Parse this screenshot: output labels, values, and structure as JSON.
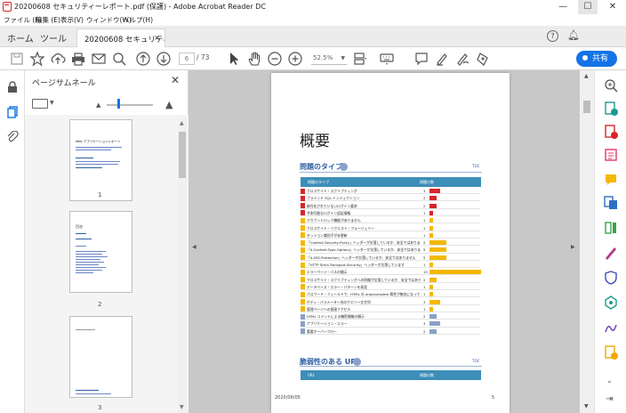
{
  "window": {
    "title": "20200608 セキュリティーレポート.pdf (保護) - Adobe Acrobat Reader DC",
    "controls": {
      "minimize": "—",
      "maximize": "☐",
      "close": "✕"
    }
  },
  "menu": [
    "ファイル (F)",
    "編集 (E)",
    "表示(V)",
    "ウィンドウ(W)",
    "ヘルプ(H)"
  ],
  "tabs": {
    "home": "ホーム",
    "tools": "ツール",
    "document": "20200608 セキュリティ...",
    "close": "×"
  },
  "toolbar": {
    "page_current": "6",
    "page_total": "/ 73",
    "zoom": "52.5%",
    "share_label": "共有"
  },
  "thumbnails": {
    "title": "ページサムネール",
    "close": "✕",
    "items": [
      {
        "label": "1",
        "heading": "Web アプリケーションレポート"
      },
      {
        "label": "2",
        "heading": "目次"
      },
      {
        "label": "3",
        "heading": ""
      }
    ]
  },
  "page": {
    "title": "概要",
    "section1": {
      "heading": "問題のタイプ",
      "top_link": "TOC",
      "col_type": "問題のタイプ",
      "col_count": "問題の数"
    },
    "section2": {
      "heading": "脆弱性のある URL",
      "top_link": "TOC",
      "col_url": "URL",
      "col_count": "問題の数"
    },
    "footer_date": "2020/06/05",
    "footer_page": "5"
  },
  "colors": {
    "high": "#d6262b",
    "medium": "#f5b800",
    "low": "#8aa0c8",
    "info": "#8aa0c8",
    "accent": "#1473e6",
    "table_header": "#3d8eb9"
  },
  "chart_data": {
    "type": "bar",
    "title": "問題のタイプ",
    "categories": [
      "クロスサイト・スクリプティング",
      "ブラインド SQL インジェクション",
      "暗号化されていないログイン要求",
      "予測可能なログイン認証情報",
      "アカウントロック機能がありません",
      "クロスサイト・リクエスト・フォージェリー",
      "セッション識別子が未更新",
      "「Content-Security-Policy」ヘッダーが欠落しているか、安全ではありません",
      "「X-Content-Type-Options」ヘッダーが欠落しているか、安全ではありません",
      "「X-XSS-Protection」ヘッダーが欠落しているか、安全ではありません",
      "「HTTP Strict-Transport-Security」ヘッダーが欠落しています",
      "エラーページ・パスの開示",
      "クロスサイト・スクリプティングへの防御が欠落しているか、安全ではありません",
      "データベース・エラー・パターンを発見",
      "パスワード・フィールドで、HTML の autocomplete 属性が無効になっていません",
      "ボディ・パラメーター内のクエリー文字列",
      "管理ページへの直接アクセス",
      "HTML コメントによる機密情報の開示",
      "アプリケーション・エラー",
      "重要オーバーフロー"
    ],
    "values": [
      3,
      2,
      2,
      1,
      1,
      1,
      1,
      5,
      5,
      5,
      1,
      15,
      2,
      1,
      1,
      3,
      1,
      2,
      3,
      2
    ],
    "severity": [
      "high",
      "high",
      "high",
      "high",
      "medium",
      "medium",
      "medium",
      "medium",
      "medium",
      "medium",
      "medium",
      "medium",
      "medium",
      "medium",
      "medium",
      "medium",
      "medium",
      "low",
      "low",
      "info"
    ],
    "xlabel": "",
    "ylabel": ""
  }
}
